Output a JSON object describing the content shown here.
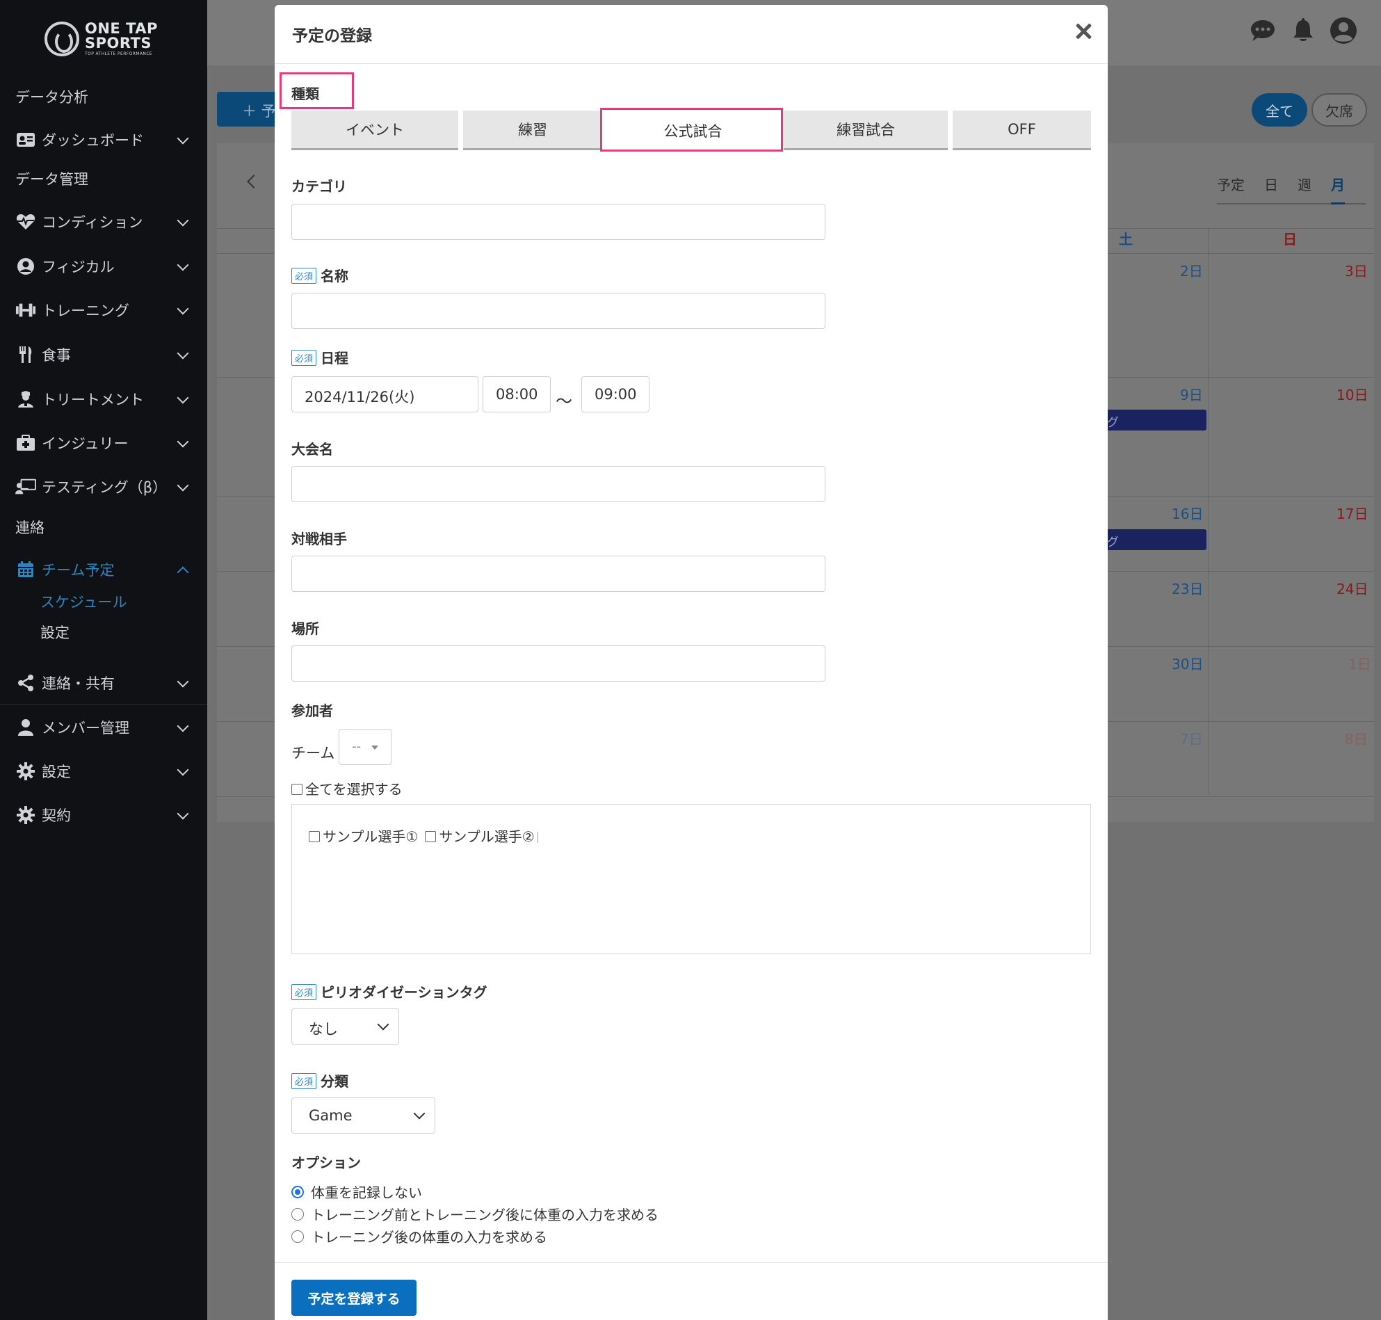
{
  "sidebar": {
    "logo": {
      "line1": "ONE TAP",
      "line2": "SPORTS",
      "tagline": "TOP ATHLETE PERFORMANCE"
    },
    "items": [
      {
        "label": "データ分析"
      },
      {
        "label": "ダッシュボード"
      },
      {
        "label": "データ管理"
      },
      {
        "label": "コンディション"
      },
      {
        "label": "フィジカル"
      },
      {
        "label": "トレーニング"
      },
      {
        "label": "食事"
      },
      {
        "label": "トリートメント"
      },
      {
        "label": "インジュリー"
      },
      {
        "label": "テスティング（β）"
      },
      {
        "label": "連絡"
      },
      {
        "label": "チーム予定"
      },
      {
        "label": "連絡・共有"
      },
      {
        "label": "メンバー管理"
      },
      {
        "label": "設定"
      },
      {
        "label": "契約"
      }
    ],
    "subitems": [
      {
        "label": "スケジュール"
      },
      {
        "label": "設定"
      }
    ]
  },
  "background": {
    "add_button": "＋ 予",
    "filter_all": "全て",
    "filter_absent": "欠席",
    "view_tabs": [
      "予定",
      "日",
      "週",
      "月"
    ],
    "weekday_sat": "土",
    "weekday_sun": "日",
    "days": [
      "2日",
      "3日",
      "9日",
      "10日",
      "16日",
      "17日",
      "23日",
      "24日",
      "30日",
      "1日",
      "7日",
      "8日"
    ],
    "event_labels": [
      "グ",
      "グ"
    ]
  },
  "modal": {
    "title": "予定の登録",
    "type_label": "種類",
    "type_tabs": [
      "イベント",
      "練習",
      "公式試合",
      "練習試合",
      "OFF"
    ],
    "required_badge": "必須",
    "category_label": "カテゴリ",
    "name_label": "名称",
    "schedule_label": "日程",
    "date_value": "2024/11/26(火)",
    "start_time": "08:00",
    "tilde": "〜",
    "end_time": "09:00",
    "tournament_label": "大会名",
    "opponent_label": "対戦相手",
    "place_label": "場所",
    "participants_label": "参加者",
    "team_label": "チーム",
    "team_select": "--",
    "select_all": "全てを選択する",
    "members": [
      "サンプル選手①",
      "サンプル選手②"
    ],
    "periodization_label": "ピリオダイゼーションタグ",
    "periodization_value": "なし",
    "classification_label": "分類",
    "classification_value": "Game",
    "options_label": "オプション",
    "options": [
      "体重を記録しない",
      "トレーニング前とトレーニング後に体重の入力を求める",
      "トレーニング後の体重の入力を求める"
    ],
    "submit": "予定を登録する"
  }
}
